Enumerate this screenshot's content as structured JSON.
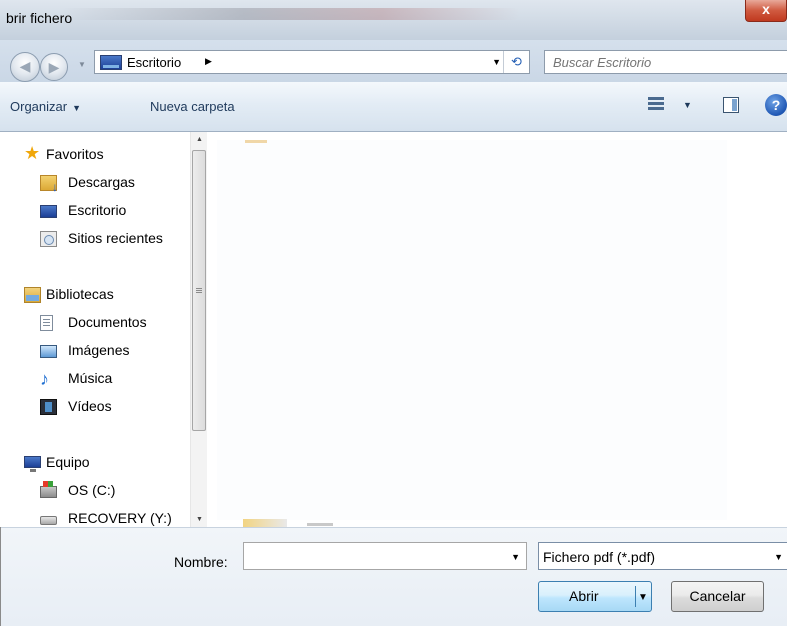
{
  "window": {
    "title": "brir fichero",
    "close_label": "x"
  },
  "address": {
    "back_icon": "back-arrow-icon",
    "forward_icon": "forward-arrow-icon",
    "breadcrumb": "Escritorio",
    "breadcrumb_arrow": "▶",
    "dropdown_arrow": "▼",
    "refresh_glyph": "⟲",
    "search_placeholder": "Buscar Escritorio"
  },
  "toolbar": {
    "organize_label": "Organizar",
    "organize_caret": "▼",
    "new_folder_label": "Nueva carpeta",
    "view_caret": "▼",
    "help_glyph": "?"
  },
  "sidebar": {
    "favorites": {
      "label": "Favoritos",
      "items": [
        {
          "label": "Descargas",
          "icon": "downloads-icon"
        },
        {
          "label": "Escritorio",
          "icon": "desktop-icon"
        },
        {
          "label": "Sitios recientes",
          "icon": "recent-places-icon"
        }
      ]
    },
    "libraries": {
      "label": "Bibliotecas",
      "items": [
        {
          "label": "Documentos",
          "icon": "documents-icon"
        },
        {
          "label": "Imágenes",
          "icon": "images-icon"
        },
        {
          "label": "Música",
          "icon": "music-icon"
        },
        {
          "label": "Vídeos",
          "icon": "videos-icon"
        }
      ]
    },
    "computer": {
      "label": "Equipo",
      "items": [
        {
          "label": "OS (C:)",
          "icon": "os-drive-icon"
        },
        {
          "label": "RECOVERY (Y:)",
          "icon": "recovery-drive-icon"
        }
      ]
    }
  },
  "footer": {
    "name_label": "Nombre:",
    "name_value": "",
    "name_dropdown": "▼",
    "filter_value": "Fichero pdf (*.pdf)",
    "filter_dropdown": "▼",
    "open_label": "Abrir",
    "open_split": "▼",
    "cancel_label": "Cancelar"
  },
  "colors": {
    "titlebar": "#cfd9e4",
    "toolbar_text": "#1e395b",
    "close_button": "#c0391f",
    "open_button_border": "#3c7fb1"
  }
}
